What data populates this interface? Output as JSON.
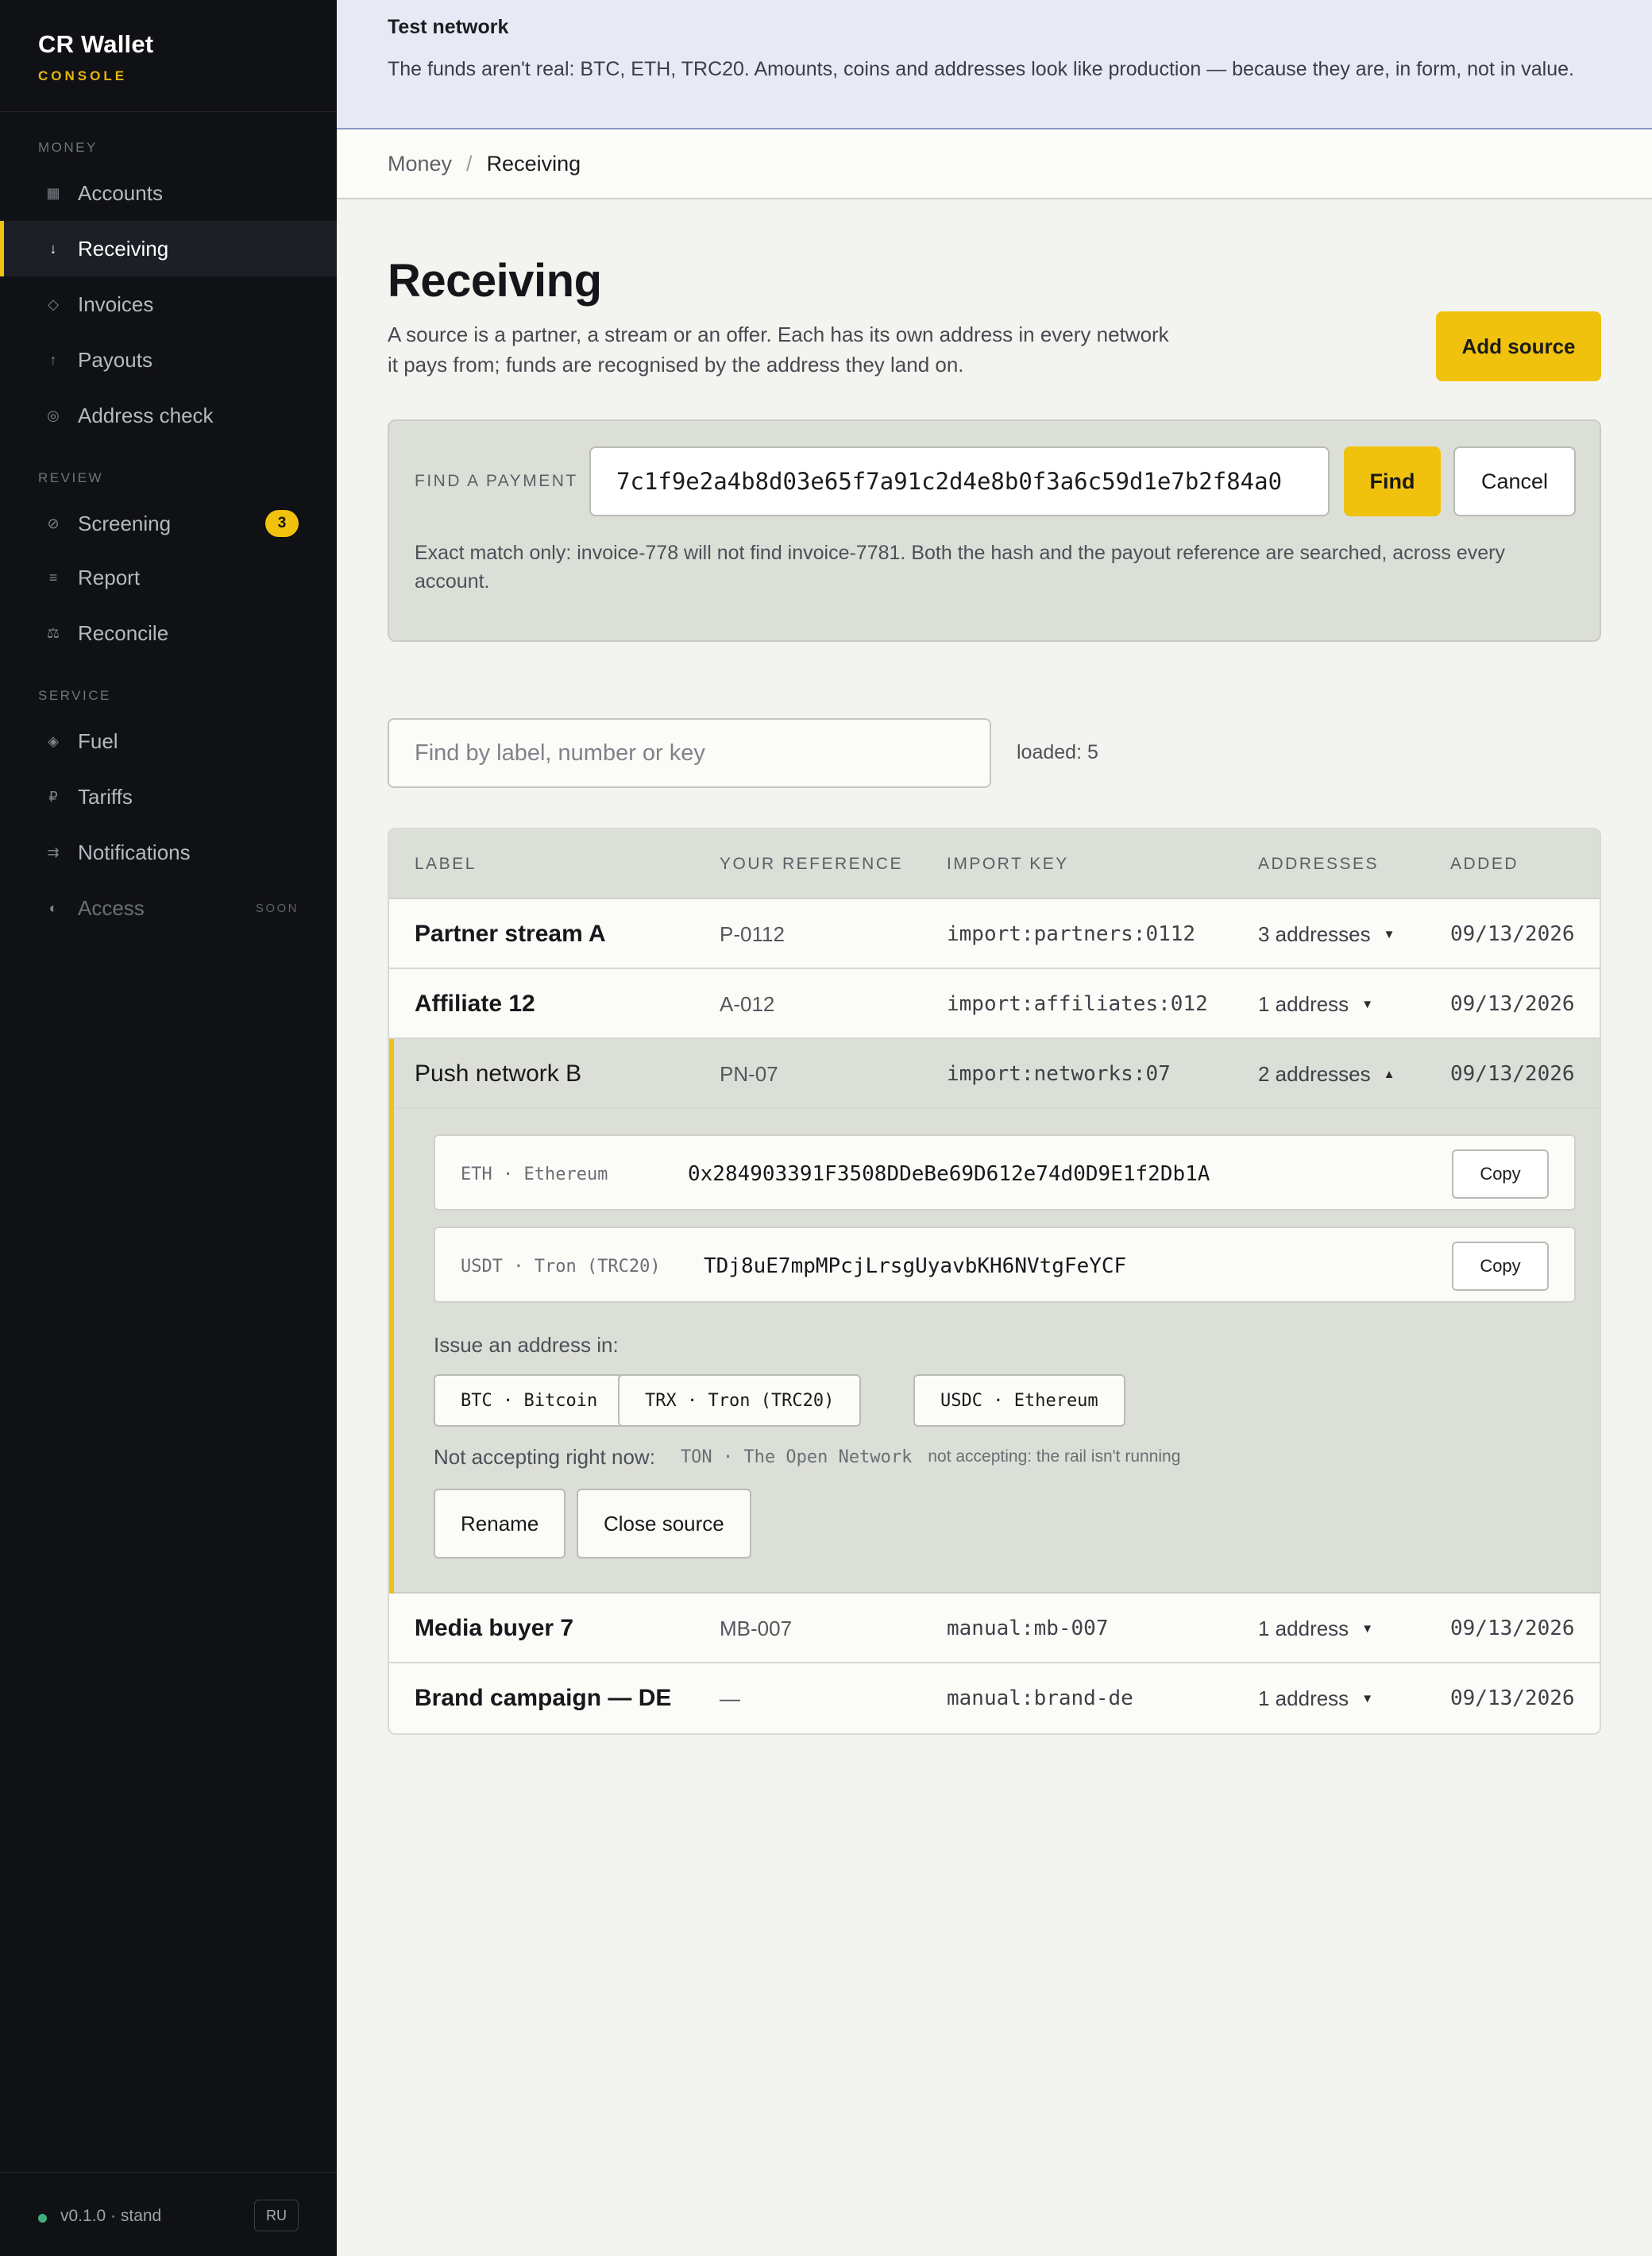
{
  "app": {
    "title": "CR Wallet",
    "subtitle": "CONSOLE"
  },
  "sidebar": {
    "sections": [
      {
        "label": "MONEY",
        "items": [
          {
            "label": "Accounts",
            "icon": "grid-icon"
          },
          {
            "label": "Receiving",
            "icon": "arrow-down-icon",
            "active": true
          },
          {
            "label": "Invoices",
            "icon": "diamond-icon"
          },
          {
            "label": "Payouts",
            "icon": "arrow-up-icon"
          },
          {
            "label": "Address check",
            "icon": "target-icon"
          }
        ]
      },
      {
        "label": "REVIEW",
        "items": [
          {
            "label": "Screening",
            "icon": "forbidden-icon",
            "badge": "3"
          },
          {
            "label": "Report",
            "icon": "lines-icon"
          },
          {
            "label": "Reconcile",
            "icon": "scales-icon"
          }
        ]
      },
      {
        "label": "SERVICE",
        "items": [
          {
            "label": "Fuel",
            "icon": "fuel-icon"
          },
          {
            "label": "Tariffs",
            "icon": "ruble-icon"
          },
          {
            "label": "Notifications",
            "icon": "arrows-icon"
          },
          {
            "label": "Access",
            "icon": "half-circle-icon",
            "tag": "SOON",
            "disabled": true
          }
        ]
      }
    ],
    "footer": {
      "version": "v0.1.0 · stand",
      "lang": "RU",
      "status_color": "#3fae7a"
    }
  },
  "banner": {
    "title": "Test network",
    "text": "The funds aren't real: BTC, ETH, TRC20. Amounts, coins and addresses look like production — because they are, in form, not in value."
  },
  "breadcrumb": {
    "parent": "Money",
    "separator": "/",
    "current": "Receiving"
  },
  "page": {
    "title": "Receiving",
    "description": "A source is a partner, a stream or an offer. Each has its own address in every network it pays from; funds are recognised by the address they land on.",
    "add_button": "Add source"
  },
  "find_payment": {
    "label": "FIND A PAYMENT",
    "value": "7c1f9e2a4b8d03e65f7a91c2d4e8b0f3a6c59d1e7b2f84a0",
    "find_button": "Find",
    "cancel_button": "Cancel",
    "hint": "Exact match only: invoice-778 will not find invoice-7781. Both the hash and the payout reference are searched, across every account."
  },
  "filter": {
    "placeholder": "Find by label, number or key",
    "loaded": "loaded: 5"
  },
  "table": {
    "columns": {
      "label": "LABEL",
      "reference": "YOUR REFERENCE",
      "key": "IMPORT KEY",
      "addresses": "ADDRESSES",
      "added": "ADDED"
    },
    "rows": [
      {
        "label": "Partner stream A",
        "reference": "P-0112",
        "key": "import:partners:0112",
        "addresses": "3 addresses",
        "added": "09/13/2026"
      },
      {
        "label": "Affiliate 12",
        "reference": "A-012",
        "key": "import:affiliates:012",
        "addresses": "1 address",
        "added": "09/13/2026"
      },
      {
        "label": "Push network B",
        "reference": "PN-07",
        "key": "import:networks:07",
        "addresses": "2 addresses",
        "added": "09/13/2026",
        "expanded": true
      },
      {
        "label": "Media buyer 7",
        "reference": "MB-007",
        "key": "manual:mb-007",
        "addresses": "1 address",
        "added": "09/13/2026"
      },
      {
        "label": "Brand campaign — DE",
        "reference": "—",
        "key": "manual:brand-de",
        "addresses": "1 address",
        "added": "09/13/2026"
      }
    ],
    "expanded_detail": {
      "addresses": [
        {
          "network": "ETH · Ethereum",
          "address": "0x284903391F3508DDeBe69D612e74d0D9E1f2Db1A",
          "copy_label": "Copy"
        },
        {
          "network": "USDT · Tron (TRC20)",
          "address": "TDj8uE7mpMPcjLrsgUyavbKH6NVtgFeYCF",
          "copy_label": "Copy"
        }
      ],
      "issue_label": "Issue an address in:",
      "issue_options": [
        "BTC · Bitcoin",
        "TRX · Tron (TRC20)",
        "USDC · Ethereum"
      ],
      "not_accepting_label": "Not accepting right now:",
      "not_accepting_network": "TON · The Open Network",
      "not_accepting_reason": "not accepting: the rail isn't running",
      "rename_button": "Rename",
      "close_button": "Close source"
    }
  },
  "colors": {
    "accent": "#f0c20e",
    "sidebar_bg": "#101114",
    "banner_bg": "#e7eaf5",
    "panel_bg": "#dcdfd7"
  }
}
